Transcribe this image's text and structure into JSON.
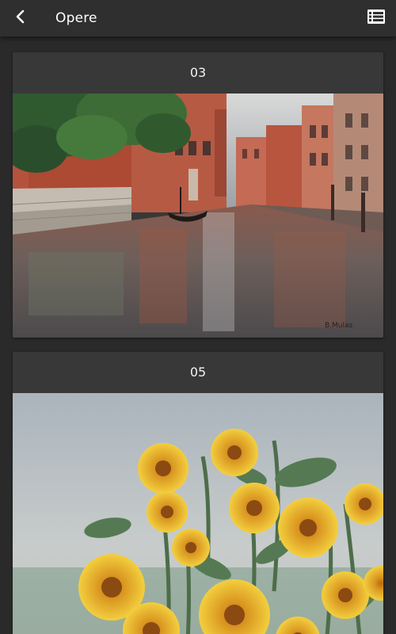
{
  "appbar": {
    "title": "Opere",
    "back_icon": "chevron-left-icon",
    "menu_icon": "list-view-icon"
  },
  "artworks": [
    {
      "label": "03",
      "image": "painting of a venetian canal with red buildings and a gondola",
      "signature": "B.Mulas"
    },
    {
      "label": "05",
      "image": "painting of yellow sunflowers against a grey sky"
    }
  ],
  "colors": {
    "background": "#2a2a2a",
    "appbar": "#2f2f2f",
    "card": "#383838",
    "text": "#ffffff"
  }
}
